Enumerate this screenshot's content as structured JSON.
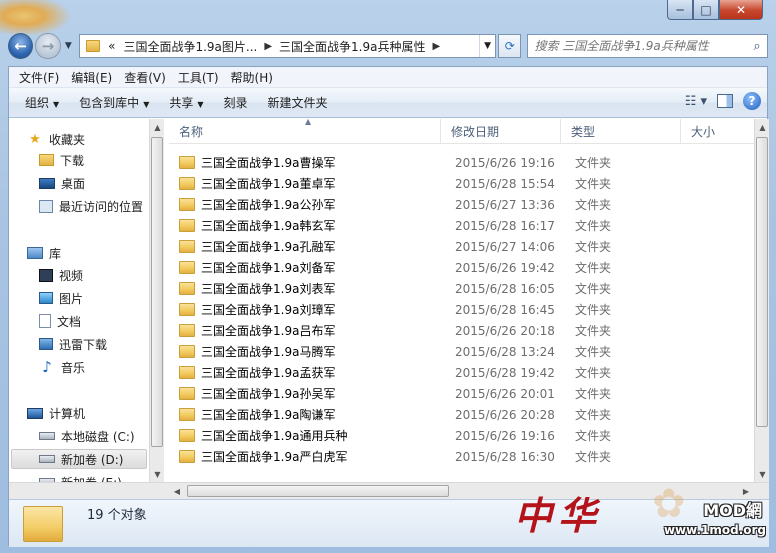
{
  "window": {
    "controls": {
      "minimize": "─",
      "maximize": "□",
      "close": "✕"
    }
  },
  "nav": {
    "back_glyph": "←",
    "forward_glyph": "→",
    "address": {
      "overflow": "«",
      "crumbs": [
        "三国全面战争1.9a图片...",
        "三国全面战争1.9a兵种属性"
      ]
    },
    "search_placeholder": "搜索 三国全面战争1.9a兵种属性"
  },
  "menu": [
    "文件(F)",
    "编辑(E)",
    "查看(V)",
    "工具(T)",
    "帮助(H)"
  ],
  "toolbar": {
    "organize": "组织",
    "include_library": "包含到库中",
    "share": "共享",
    "burn": "刻录",
    "new_folder": "新建文件夹",
    "help_glyph": "?"
  },
  "navpane": {
    "favorites": {
      "label": "收藏夹",
      "icon": "star-icon",
      "items": [
        "下载",
        "桌面",
        "最近访问的位置"
      ]
    },
    "libraries": {
      "label": "库",
      "icon": "library-icon",
      "items": [
        "视频",
        "图片",
        "文档",
        "迅雷下载",
        "音乐"
      ]
    },
    "computer": {
      "label": "计算机",
      "icon": "computer-icon",
      "items": [
        "本地磁盘 (C:)",
        "新加卷 (D:)",
        "新加卷 (E:)"
      ],
      "selected": "新加卷 (D:)"
    }
  },
  "columns": {
    "name": "名称",
    "date": "修改日期",
    "type": "类型",
    "size": "大小"
  },
  "files": [
    {
      "name": "三国全面战争1.9a曹操军",
      "date": "2015/6/26 19:16",
      "type": "文件夹"
    },
    {
      "name": "三国全面战争1.9a董卓军",
      "date": "2015/6/28 15:54",
      "type": "文件夹"
    },
    {
      "name": "三国全面战争1.9a公孙军",
      "date": "2015/6/27 13:36",
      "type": "文件夹"
    },
    {
      "name": "三国全面战争1.9a韩玄军",
      "date": "2015/6/28 16:17",
      "type": "文件夹"
    },
    {
      "name": "三国全面战争1.9a孔融军",
      "date": "2015/6/27 14:06",
      "type": "文件夹"
    },
    {
      "name": "三国全面战争1.9a刘备军",
      "date": "2015/6/26 19:42",
      "type": "文件夹"
    },
    {
      "name": "三国全面战争1.9a刘表军",
      "date": "2015/6/28 16:05",
      "type": "文件夹"
    },
    {
      "name": "三国全面战争1.9a刘璋军",
      "date": "2015/6/28 16:45",
      "type": "文件夹"
    },
    {
      "name": "三国全面战争1.9a吕布军",
      "date": "2015/6/26 20:18",
      "type": "文件夹"
    },
    {
      "name": "三国全面战争1.9a马腾军",
      "date": "2015/6/28 13:24",
      "type": "文件夹"
    },
    {
      "name": "三国全面战争1.9a孟获军",
      "date": "2015/6/28 19:42",
      "type": "文件夹"
    },
    {
      "name": "三国全面战争1.9a孙吴军",
      "date": "2015/6/26 20:01",
      "type": "文件夹"
    },
    {
      "name": "三国全面战争1.9a陶谦军",
      "date": "2015/6/26 20:28",
      "type": "文件夹"
    },
    {
      "name": "三国全面战争1.9a通用兵种",
      "date": "2015/6/26 19:16",
      "type": "文件夹"
    },
    {
      "name": "三国全面战争1.9a严白虎军",
      "date": "2015/6/28 16:30",
      "type": "文件夹"
    }
  ],
  "status": {
    "count": "19 个对象"
  },
  "watermark": {
    "chinese": "中华",
    "brand": "MOD網",
    "url": "www.1mod.org"
  }
}
